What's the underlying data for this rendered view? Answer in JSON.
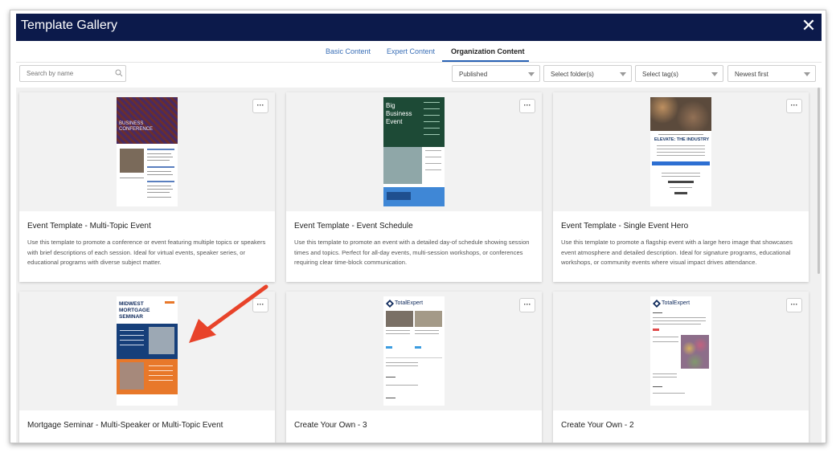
{
  "window": {
    "title": "Template Gallery",
    "close_glyph": "✕"
  },
  "tabs": [
    {
      "label": "Basic Content",
      "active": false
    },
    {
      "label": "Expert Content",
      "active": false
    },
    {
      "label": "Organization Content",
      "active": true
    }
  ],
  "filters": {
    "search_placeholder": "Search by name",
    "status": "Published",
    "folders": "Select folder(s)",
    "tags": "Select tag(s)",
    "sort": "Newest first"
  },
  "more_label": "···",
  "cards": [
    {
      "title": "Event Template - Multi-Topic Event",
      "description": "Use this template to promote a conference or event featuring multiple topics or speakers with brief descriptions of each session. Ideal for virtual events, speaker series, or educational programs with diverse subject matter.",
      "thumb_title": "BUSINESS CONFERENCE"
    },
    {
      "title": "Event Template - Event Schedule",
      "description": "Use this template to promote an event with a detailed day-of schedule showing session times and topics. Perfect for all-day events, multi-session workshops, or conferences requiring clear time-block communication.",
      "thumb_title": "Big Business Event"
    },
    {
      "title": "Event Template - Single Event Hero",
      "description": "Use this template to promote a flagship event with a large hero image that showcases event atmosphere and detailed description. Ideal for signature programs, educational workshops, or community events where visual impact drives attendance.",
      "thumb_title": "ELEVATE: THE INDUSTRY"
    },
    {
      "title": "Mortgage Seminar - Multi-Speaker or Multi-Topic Event",
      "description": "",
      "thumb_title": "MIDWEST MORTGAGE SEMINAR"
    },
    {
      "title": "Create Your Own - 3",
      "description": "",
      "thumb_title": "TotalExpert"
    },
    {
      "title": "Create Your Own - 2",
      "description": "",
      "thumb_title": "TotalExpert"
    }
  ],
  "colors": {
    "titlebar": "#0c1a4b",
    "tab_active_underline": "#2a63b5",
    "link": "#3a6fb7",
    "annotation_arrow": "#e8432a"
  }
}
